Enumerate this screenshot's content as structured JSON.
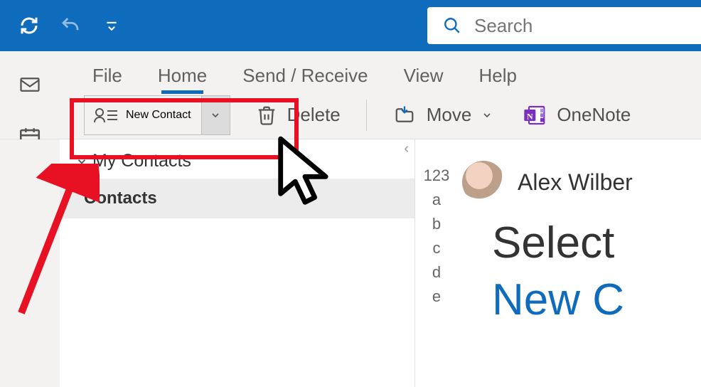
{
  "search": {
    "placeholder": "Search"
  },
  "tabs": {
    "file": "File",
    "home": "Home",
    "sendreceive": "Send / Receive",
    "view": "View",
    "help": "Help"
  },
  "ribbon": {
    "new_contact": "New Contact",
    "delete": "Delete",
    "move": "Move",
    "onenote": "OneNote"
  },
  "nav": {
    "group_header": "My Contacts",
    "contacts_item": "Contacts"
  },
  "az": {
    "all": "123",
    "a": "a",
    "b": "b",
    "c": "c",
    "d": "d",
    "e": "e"
  },
  "contact": {
    "name": "Alex Wilber"
  },
  "overlay": {
    "line1": "Select",
    "line2": "New C"
  }
}
